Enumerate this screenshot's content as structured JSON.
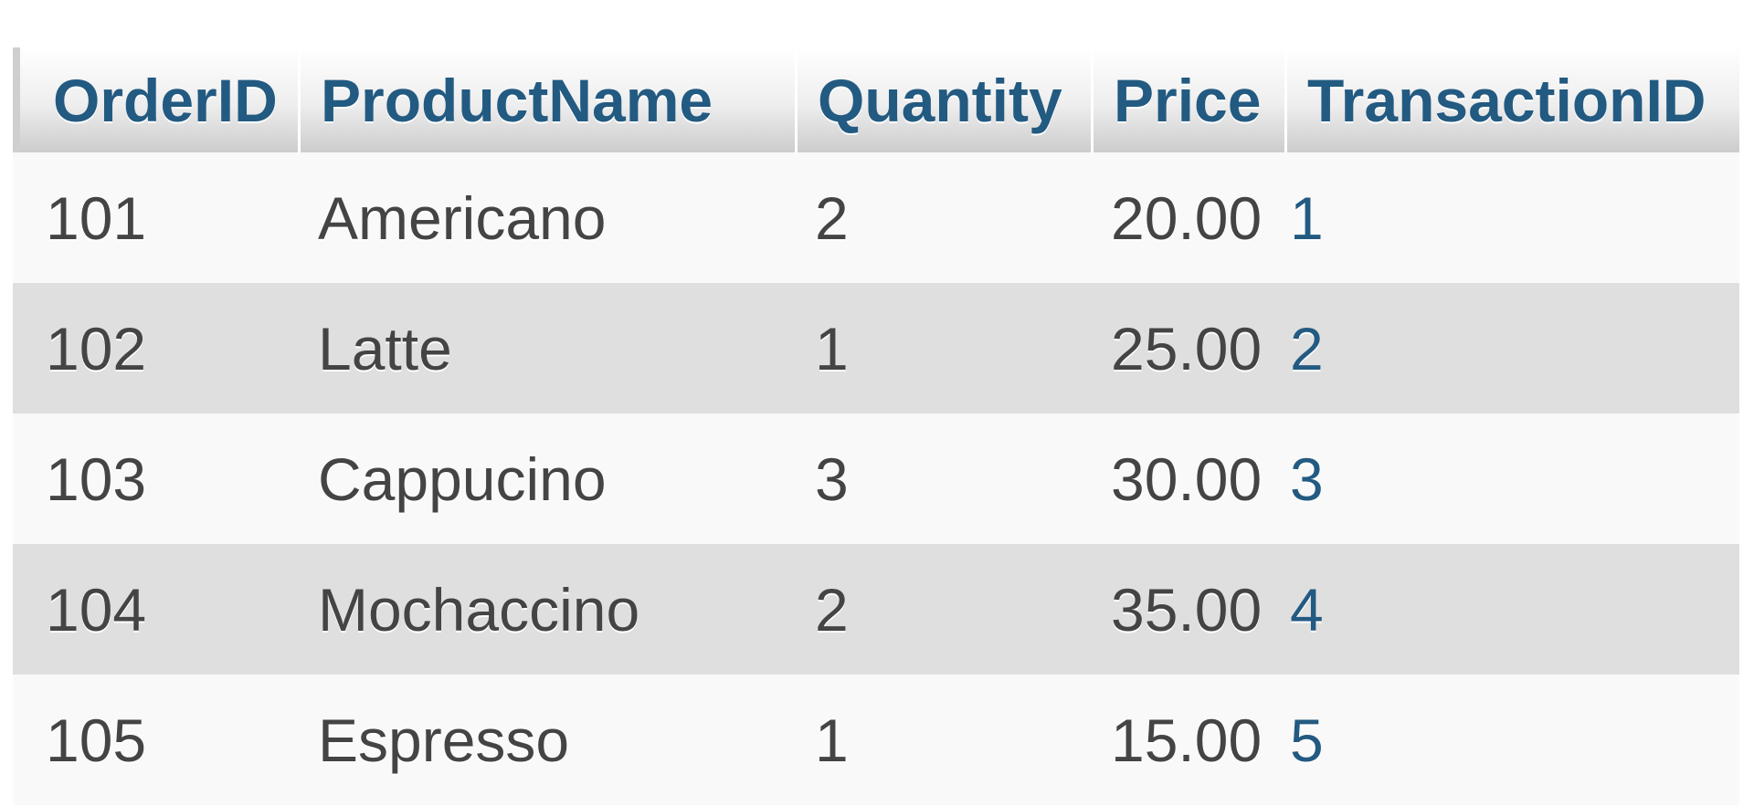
{
  "table": {
    "columns": [
      "OrderID",
      "ProductName",
      "Quantity",
      "Price",
      "TransactionID"
    ],
    "rows": [
      {
        "order_id": "101",
        "product_name": "Americano",
        "quantity": "2",
        "price": "20.00",
        "transaction_id": "1"
      },
      {
        "order_id": "102",
        "product_name": "Latte",
        "quantity": "1",
        "price": "25.00",
        "transaction_id": "2"
      },
      {
        "order_id": "103",
        "product_name": "Cappucino",
        "quantity": "3",
        "price": "30.00",
        "transaction_id": "3"
      },
      {
        "order_id": "104",
        "product_name": "Mochaccino",
        "quantity": "2",
        "price": "35.00",
        "transaction_id": "4"
      },
      {
        "order_id": "105",
        "product_name": "Espresso",
        "quantity": "1",
        "price": "15.00",
        "transaction_id": "5"
      }
    ]
  },
  "colors": {
    "header_text": "#235a81",
    "cell_text": "#444444",
    "row_odd": "#f9f9f9",
    "row_even": "#dfdfdf"
  }
}
